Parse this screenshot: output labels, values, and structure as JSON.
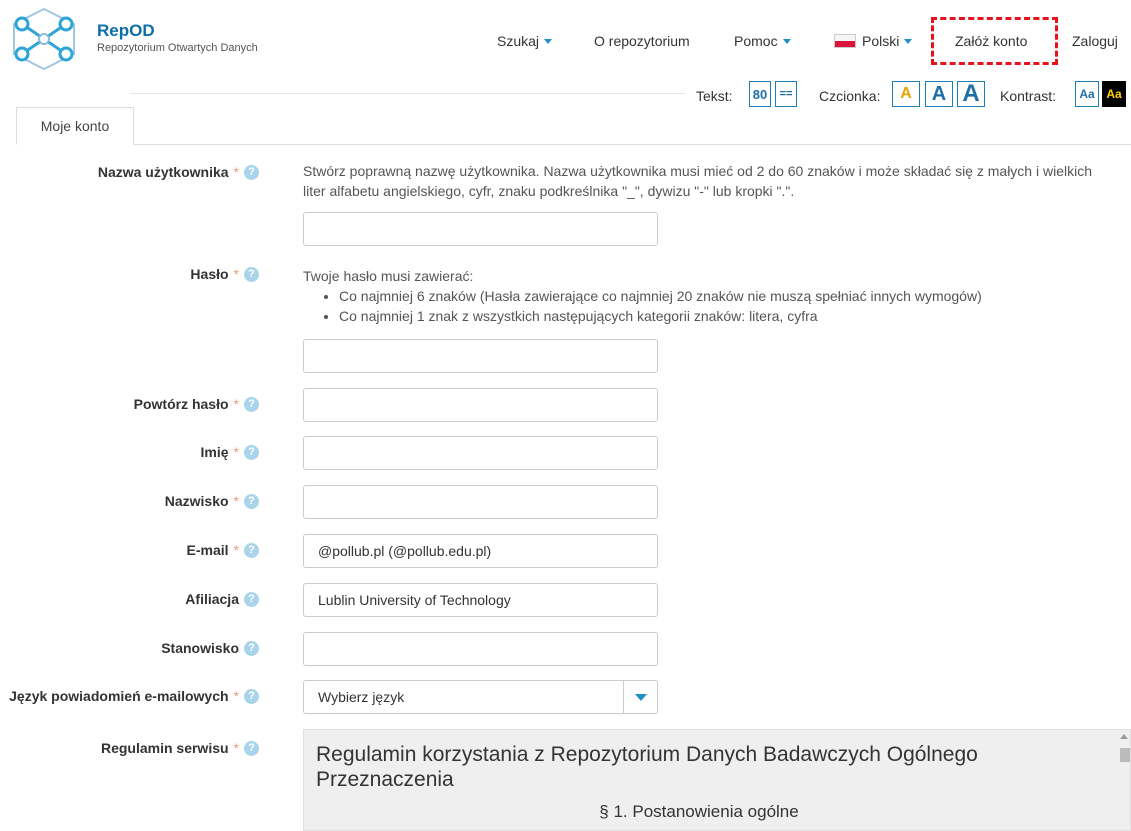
{
  "brand": {
    "name": "RepOD",
    "subtitle": "Repozytorium Otwartych Danych"
  },
  "nav": {
    "search": "Szukaj",
    "about": "O repozytorium",
    "help": "Pomoc",
    "language": "Polski",
    "register": "Załóż konto",
    "login": "Zaloguj"
  },
  "accessibility": {
    "text_label": "Tekst:",
    "text_width": "80",
    "text_spacing": "==",
    "font_label": "Czcionka:",
    "font_small": "A",
    "font_medium": "A",
    "font_large": "A",
    "contrast_label": "Kontrast:",
    "contrast_normal": "Aa",
    "contrast_high": "Aa"
  },
  "tabs": {
    "my_account": "Moje konto"
  },
  "form": {
    "required_mark": "*",
    "help_glyph": "?",
    "username": {
      "label": "Nazwa użytkownika",
      "hint": "Stwórz poprawną nazwę użytkownika. Nazwa użytkownika musi mieć od 2 do 60 znaków i może składać się z małych i wielkich liter alfabetu angielskiego, cyfr, znaku podkreślnika \"_\", dywizu \"-\" lub kropki \".\".",
      "value": ""
    },
    "password": {
      "label": "Hasło",
      "hint_intro": "Twoje hasło musi zawierać:",
      "rules": [
        "Co najmniej 6 znaków (Hasła zawierające co najmniej 20 znaków nie muszą spełniać innych wymogów)",
        "Co najmniej 1 znak z wszystkich następujących kategorii znaków: litera, cyfra"
      ],
      "value": ""
    },
    "password_repeat": {
      "label": "Powtórz hasło",
      "value": ""
    },
    "first_name": {
      "label": "Imię",
      "value": ""
    },
    "last_name": {
      "label": "Nazwisko",
      "value": ""
    },
    "email": {
      "label": "E-mail",
      "value": "@pollub.pl (@pollub.edu.pl)"
    },
    "affiliation": {
      "label": "Afiliacja",
      "value": "Lublin University of Technology"
    },
    "position": {
      "label": "Stanowisko",
      "value": ""
    },
    "notification_language": {
      "label": "Język powiadomień e-mailowych",
      "selected": "Wybierz język"
    },
    "terms": {
      "label": "Regulamin serwisu",
      "title": "Regulamin korzystania z Repozytorium Danych Badawczych Ogólnego Przeznaczenia",
      "section": "§ 1. Postanowienia ogólne"
    }
  },
  "colors": {
    "brand": "#0d6fa8",
    "accent": "#1e90c8",
    "highlight": "#e8121b",
    "required": "#e59a7a"
  }
}
